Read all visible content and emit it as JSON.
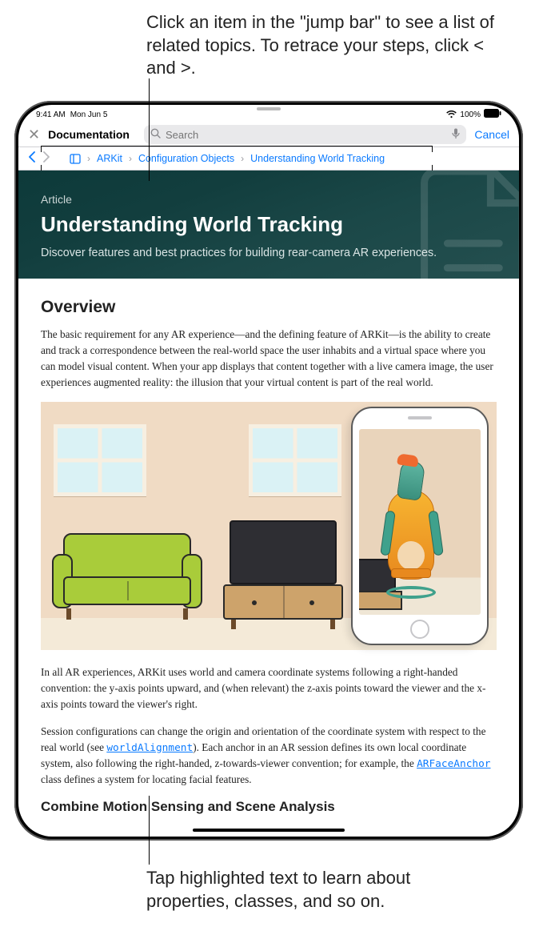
{
  "callouts": {
    "top": "Click an item in the \"jump bar\" to see a list of related topics. To retrace your steps, click < and >.",
    "bottom": "Tap highlighted text to learn about properties, classes, and so on."
  },
  "status": {
    "time": "9:41 AM",
    "date": "Mon Jun 5",
    "battery": "100%"
  },
  "toolbar": {
    "title": "Documentation",
    "search_placeholder": "Search",
    "cancel": "Cancel"
  },
  "jumpbar": {
    "items": [
      "ARKit",
      "Configuration Objects",
      "Understanding World Tracking"
    ]
  },
  "hero": {
    "doc_type": "Article",
    "title": "Understanding World Tracking",
    "subtitle": "Discover features and best practices for building rear-camera AR experiences."
  },
  "article": {
    "overview_heading": "Overview",
    "p1": "The basic requirement for any AR experience—and the defining feature of ARKit—is the ability to create and track a correspondence between the real-world space the user inhabits and a virtual space where you can model visual content. When your app displays that content together with a live camera image, the user experiences augmented reality: the illusion that your virtual content is part of the real world.",
    "p2": "In all AR experiences, ARKit uses world and camera coordinate systems following a right-handed convention: the y-axis points upward, and (when relevant) the z-axis points toward the viewer and the x-axis points toward the viewer's right.",
    "p3_a": "Session configurations can change the origin and orientation of the coordinate system with respect to the real world (see ",
    "p3_code1": "worldAlignment",
    "p3_b": "). Each anchor in an AR session defines its own local coordinate system, also following the right-handed, z-towards-viewer convention; for example, the ",
    "p3_code2": "ARFaceAnchor",
    "p3_c": " class defines a system for locating facial features.",
    "h3_next": "Combine Motion Sensing and Scene Analysis"
  }
}
